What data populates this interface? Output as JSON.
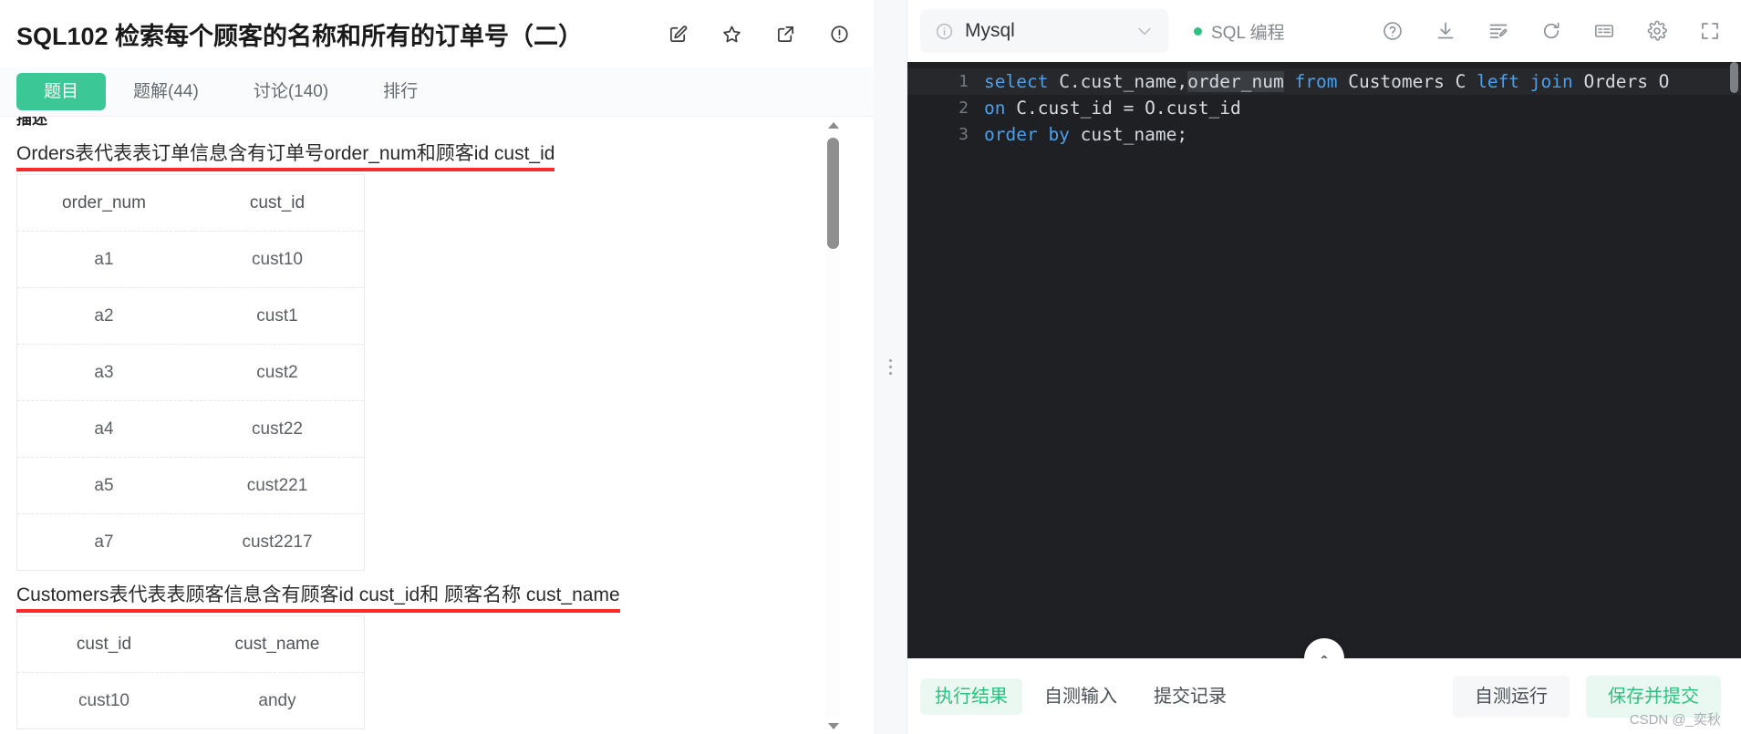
{
  "left": {
    "title": "SQL102  检索每个顾客的名称和所有的订单号（二）",
    "title_actions": [
      {
        "name": "note-edit-icon",
        "label": "笔记"
      },
      {
        "name": "star-icon",
        "label": "收藏"
      },
      {
        "name": "share-external-icon",
        "label": "分享"
      },
      {
        "name": "report-info-icon",
        "label": "反馈"
      }
    ],
    "tabs": [
      {
        "label": "题目",
        "active": true
      },
      {
        "label": "题解(44)",
        "active": false
      },
      {
        "label": "讨论(140)",
        "active": false
      },
      {
        "label": "排行",
        "active": false
      }
    ],
    "desc_heading": "描述",
    "paragraph_1": "Orders表代表表订单信息含有订单号order_num和顾客id cust_id",
    "table_1": {
      "headers": [
        "order_num",
        "cust_id"
      ],
      "rows": [
        [
          "a1",
          "cust10"
        ],
        [
          "a2",
          "cust1"
        ],
        [
          "a3",
          "cust2"
        ],
        [
          "a4",
          "cust22"
        ],
        [
          "a5",
          "cust221"
        ],
        [
          "a7",
          "cust2217"
        ]
      ]
    },
    "paragraph_2": "Customers表代表表顾客信息含有顾客id cust_id和 顾客名称 cust_name",
    "table_2": {
      "headers": [
        "cust_id",
        "cust_name"
      ],
      "rows": [
        [
          "cust10",
          "andy"
        ]
      ]
    },
    "underline_color": "#fb2a2a",
    "accent_color": "#3cc896"
  },
  "editor": {
    "db": {
      "label": "Mysql",
      "info_icon": "info-circle-icon",
      "caret_icon": "chevron-down-icon"
    },
    "mode": {
      "label": "SQL 编程",
      "dot_color": "#2fbf7f"
    },
    "toolbar_icons": [
      {
        "name": "help-circle-icon",
        "label": "帮助"
      },
      {
        "name": "download-icon",
        "label": "下载"
      },
      {
        "name": "format-code-icon",
        "label": "格式化"
      },
      {
        "name": "refresh-icon",
        "label": "重置"
      },
      {
        "name": "keyboard-shortcut-icon",
        "label": "快捷键"
      },
      {
        "name": "settings-gear-icon",
        "label": "设置"
      },
      {
        "name": "fullscreen-icon",
        "label": "全屏"
      }
    ],
    "code_lines": [
      {
        "number": "1",
        "current": true,
        "tokens": [
          {
            "t": "select",
            "k": true
          },
          {
            "t": " C.cust_name,",
            "k": false
          },
          {
            "t": "order_num",
            "k": false,
            "hl": true
          },
          {
            "t": " ",
            "k": false
          },
          {
            "t": "from",
            "k": true
          },
          {
            "t": " Customers C ",
            "k": false
          },
          {
            "t": "left join",
            "k": true
          },
          {
            "t": " Orders O",
            "k": false
          }
        ]
      },
      {
        "number": "2",
        "current": false,
        "tokens": [
          {
            "t": "on",
            "k": true
          },
          {
            "t": " C.cust_id = O.cust_id",
            "k": false
          }
        ]
      },
      {
        "number": "3",
        "current": false,
        "tokens": [
          {
            "t": "order by",
            "k": true
          },
          {
            "t": " cust_name;",
            "k": false
          }
        ]
      }
    ],
    "collapse_icon": "chevron-up-icon",
    "bottom_tabs": [
      {
        "label": "执行结果",
        "active": true
      },
      {
        "label": "自测输入",
        "active": false
      },
      {
        "label": "提交记录",
        "active": false
      }
    ],
    "btn_selftest": "自测运行",
    "btn_submit": "保存并提交"
  },
  "watermark": "CSDN @_奕秋"
}
